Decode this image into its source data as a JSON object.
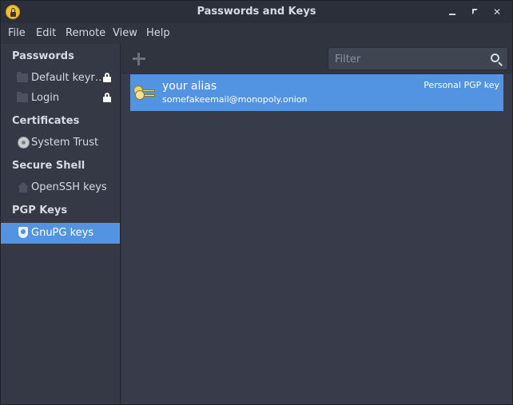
{
  "window": {
    "title": "Passwords and Keys",
    "icon": "padlock-app-icon",
    "controls": [
      "minimize-icon",
      "maximize-icon",
      "close-icon"
    ]
  },
  "menubar": {
    "items": [
      "File",
      "Edit",
      "Remote",
      "View",
      "Help"
    ]
  },
  "sidebar": {
    "sections": [
      {
        "header": "Passwords",
        "items": [
          {
            "label": "Default keyr…",
            "icon": "folder-icon",
            "locked": true
          },
          {
            "label": "Login",
            "icon": "folder-icon",
            "locked": true
          }
        ]
      },
      {
        "header": "Certificates",
        "items": [
          {
            "label": "System Trust",
            "icon": "certificate-icon"
          }
        ]
      },
      {
        "header": "Secure Shell",
        "items": [
          {
            "label": "OpenSSH keys",
            "icon": "home-icon"
          }
        ]
      },
      {
        "header": "PGP Keys",
        "items": [
          {
            "label": "GnuPG keys",
            "icon": "shield-icon",
            "selected": true
          }
        ]
      }
    ]
  },
  "toolbar": {
    "add_icon": "plus-icon",
    "search_placeholder": "Filter",
    "search_icon": "search-icon"
  },
  "keys": [
    {
      "name": "your alias",
      "email": "somefakeemail@monopoly.onion",
      "type": "Personal PGP key",
      "icon": "key-icon",
      "selected": true
    }
  ],
  "colors": {
    "accent": "#5294e2",
    "background": "#383c4a",
    "sidebar": "#353945"
  }
}
